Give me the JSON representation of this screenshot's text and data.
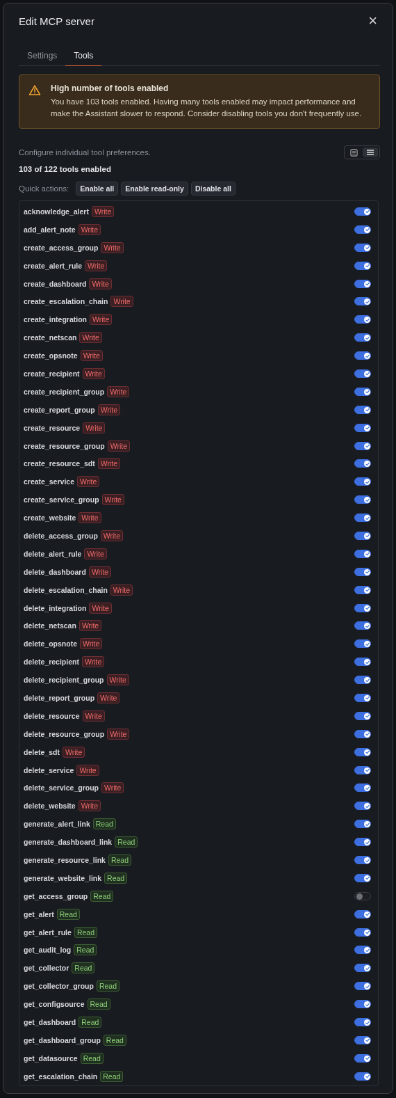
{
  "dialog": {
    "title": "Edit MCP server",
    "close": "×"
  },
  "tabs": [
    {
      "label": "Settings",
      "selected": false
    },
    {
      "label": "Tools",
      "selected": true
    }
  ],
  "alert": {
    "title": "High number of tools enabled",
    "message": "You have 103 tools enabled. Having many tools enabled may impact performance and make the Assistant slower to respond. Consider disabling tools you don't frequently use."
  },
  "description": "Configure individual tool preferences.",
  "view_modes": [
    {
      "kind": "grid",
      "selected": false
    },
    {
      "kind": "list",
      "selected": true
    }
  ],
  "count": "103 of 122 tools enabled",
  "quick_actions": {
    "label": "Quick actions:",
    "buttons": [
      "Enable all",
      "Enable read-only",
      "Disable all"
    ]
  },
  "tools": [
    {
      "name": "acknowledge_alert",
      "kind": "write",
      "badge": "Write",
      "on": true
    },
    {
      "name": "add_alert_note",
      "kind": "write",
      "badge": "Write",
      "on": true
    },
    {
      "name": "create_access_group",
      "kind": "write",
      "badge": "Write",
      "on": true
    },
    {
      "name": "create_alert_rule",
      "kind": "write",
      "badge": "Write",
      "on": true
    },
    {
      "name": "create_dashboard",
      "kind": "write",
      "badge": "Write",
      "on": true
    },
    {
      "name": "create_escalation_chain",
      "kind": "write",
      "badge": "Write",
      "on": true
    },
    {
      "name": "create_integration",
      "kind": "write",
      "badge": "Write",
      "on": true
    },
    {
      "name": "create_netscan",
      "kind": "write",
      "badge": "Write",
      "on": true
    },
    {
      "name": "create_opsnote",
      "kind": "write",
      "badge": "Write",
      "on": true
    },
    {
      "name": "create_recipient",
      "kind": "write",
      "badge": "Write",
      "on": true
    },
    {
      "name": "create_recipient_group",
      "kind": "write",
      "badge": "Write",
      "on": true
    },
    {
      "name": "create_report_group",
      "kind": "write",
      "badge": "Write",
      "on": true
    },
    {
      "name": "create_resource",
      "kind": "write",
      "badge": "Write",
      "on": true
    },
    {
      "name": "create_resource_group",
      "kind": "write",
      "badge": "Write",
      "on": true
    },
    {
      "name": "create_resource_sdt",
      "kind": "write",
      "badge": "Write",
      "on": true
    },
    {
      "name": "create_service",
      "kind": "write",
      "badge": "Write",
      "on": true
    },
    {
      "name": "create_service_group",
      "kind": "write",
      "badge": "Write",
      "on": true
    },
    {
      "name": "create_website",
      "kind": "write",
      "badge": "Write",
      "on": true
    },
    {
      "name": "delete_access_group",
      "kind": "write",
      "badge": "Write",
      "on": true
    },
    {
      "name": "delete_alert_rule",
      "kind": "write",
      "badge": "Write",
      "on": true
    },
    {
      "name": "delete_dashboard",
      "kind": "write",
      "badge": "Write",
      "on": true
    },
    {
      "name": "delete_escalation_chain",
      "kind": "write",
      "badge": "Write",
      "on": true
    },
    {
      "name": "delete_integration",
      "kind": "write",
      "badge": "Write",
      "on": true
    },
    {
      "name": "delete_netscan",
      "kind": "write",
      "badge": "Write",
      "on": true
    },
    {
      "name": "delete_opsnote",
      "kind": "write",
      "badge": "Write",
      "on": true
    },
    {
      "name": "delete_recipient",
      "kind": "write",
      "badge": "Write",
      "on": true
    },
    {
      "name": "delete_recipient_group",
      "kind": "write",
      "badge": "Write",
      "on": true
    },
    {
      "name": "delete_report_group",
      "kind": "write",
      "badge": "Write",
      "on": true
    },
    {
      "name": "delete_resource",
      "kind": "write",
      "badge": "Write",
      "on": true
    },
    {
      "name": "delete_resource_group",
      "kind": "write",
      "badge": "Write",
      "on": true
    },
    {
      "name": "delete_sdt",
      "kind": "write",
      "badge": "Write",
      "on": true
    },
    {
      "name": "delete_service",
      "kind": "write",
      "badge": "Write",
      "on": true
    },
    {
      "name": "delete_service_group",
      "kind": "write",
      "badge": "Write",
      "on": true
    },
    {
      "name": "delete_website",
      "kind": "write",
      "badge": "Write",
      "on": true
    },
    {
      "name": "generate_alert_link",
      "kind": "read",
      "badge": "Read",
      "on": true
    },
    {
      "name": "generate_dashboard_link",
      "kind": "read",
      "badge": "Read",
      "on": true
    },
    {
      "name": "generate_resource_link",
      "kind": "read",
      "badge": "Read",
      "on": true
    },
    {
      "name": "generate_website_link",
      "kind": "read",
      "badge": "Read",
      "on": true
    },
    {
      "name": "get_access_group",
      "kind": "read",
      "badge": "Read",
      "on": false
    },
    {
      "name": "get_alert",
      "kind": "read",
      "badge": "Read",
      "on": true
    },
    {
      "name": "get_alert_rule",
      "kind": "read",
      "badge": "Read",
      "on": true
    },
    {
      "name": "get_audit_log",
      "kind": "read",
      "badge": "Read",
      "on": true
    },
    {
      "name": "get_collector",
      "kind": "read",
      "badge": "Read",
      "on": true
    },
    {
      "name": "get_collector_group",
      "kind": "read",
      "badge": "Read",
      "on": true
    },
    {
      "name": "get_configsource",
      "kind": "read",
      "badge": "Read",
      "on": true
    },
    {
      "name": "get_dashboard",
      "kind": "read",
      "badge": "Read",
      "on": true
    },
    {
      "name": "get_dashboard_group",
      "kind": "read",
      "badge": "Read",
      "on": true
    },
    {
      "name": "get_datasource",
      "kind": "read",
      "badge": "Read",
      "on": true
    },
    {
      "name": "get_escalation_chain",
      "kind": "read",
      "badge": "Read",
      "on": true
    }
  ]
}
